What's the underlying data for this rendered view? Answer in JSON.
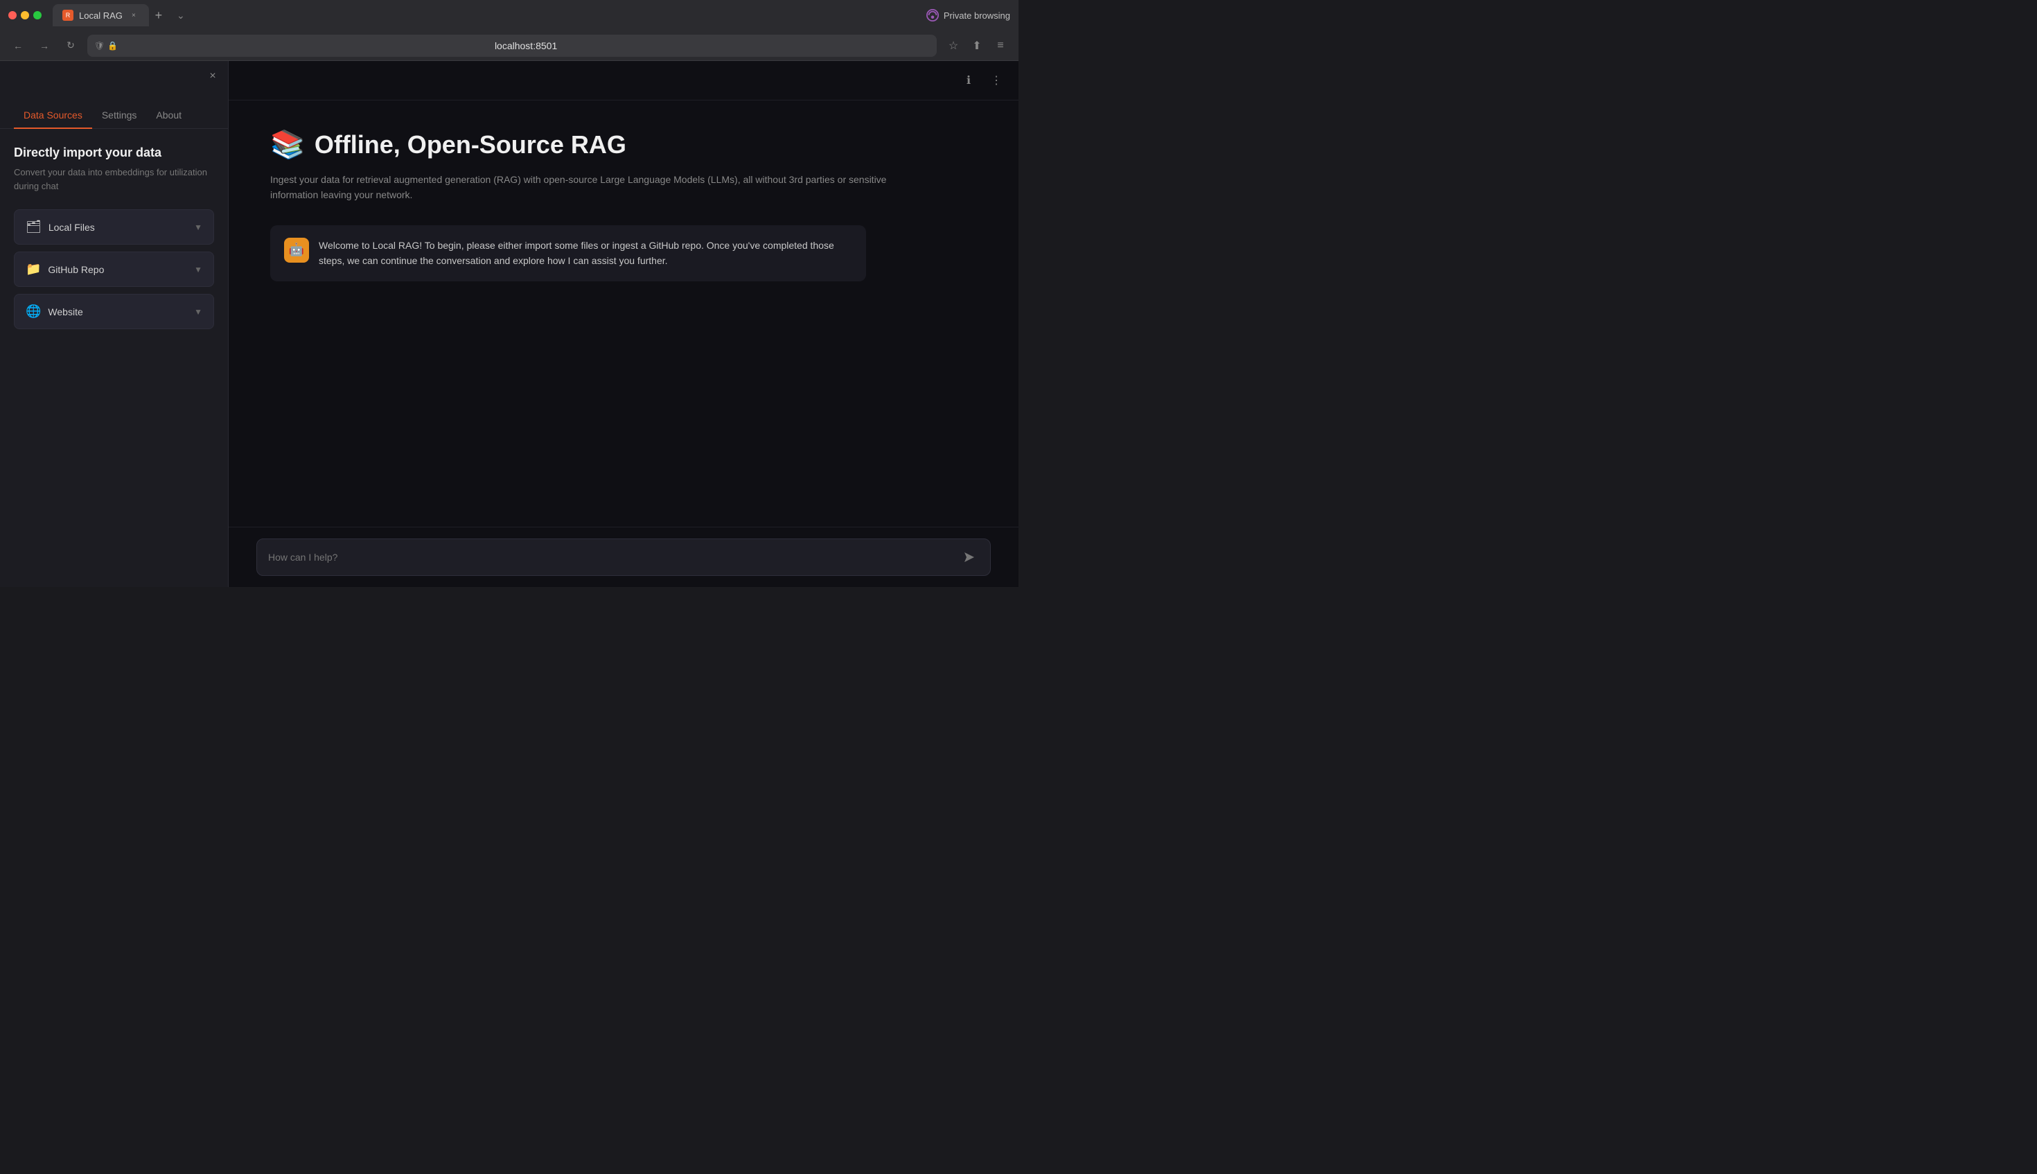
{
  "browser": {
    "tab_title": "Local RAG",
    "tab_favicon_text": "R",
    "close_tab_label": "×",
    "new_tab_label": "+",
    "private_browsing_label": "Private browsing",
    "address_url": "localhost:8501",
    "back_label": "←",
    "forward_label": "→",
    "refresh_label": "↻",
    "bookmark_label": "☆",
    "extensions_label": "⬆",
    "menu_label": "≡",
    "tab_dropdown_label": "⌄"
  },
  "sidebar": {
    "close_label": "×",
    "tabs": [
      {
        "id": "data-sources",
        "label": "Data Sources",
        "active": true
      },
      {
        "id": "settings",
        "label": "Settings",
        "active": false
      },
      {
        "id": "about",
        "label": "About",
        "active": false
      }
    ],
    "title": "Directly import your data",
    "subtitle": "Convert your data into embeddings for utilization during chat",
    "data_sources": [
      {
        "id": "local-files",
        "icon": "🗂",
        "label": "Local Files"
      },
      {
        "id": "github-repo",
        "icon": "📁",
        "label": "GitHub Repo"
      },
      {
        "id": "website",
        "icon": "🌐",
        "label": "Website"
      }
    ]
  },
  "main": {
    "toolbar": {
      "info_label": "ℹ",
      "more_label": "⋮"
    },
    "hero_emoji": "📚",
    "hero_title": "Offline, Open-Source RAG",
    "hero_description": "Ingest your data for retrieval augmented generation (RAG) with open-source Large Language Models (LLMs), all without 3rd parties or sensitive information leaving your network.",
    "bot_avatar_emoji": "🤖",
    "welcome_message": "Welcome to Local RAG! To begin, please either import some files or ingest a GitHub repo. Once you've completed those steps, we can continue the conversation and explore how I can assist you further.",
    "chat_placeholder": "How can I help?"
  }
}
